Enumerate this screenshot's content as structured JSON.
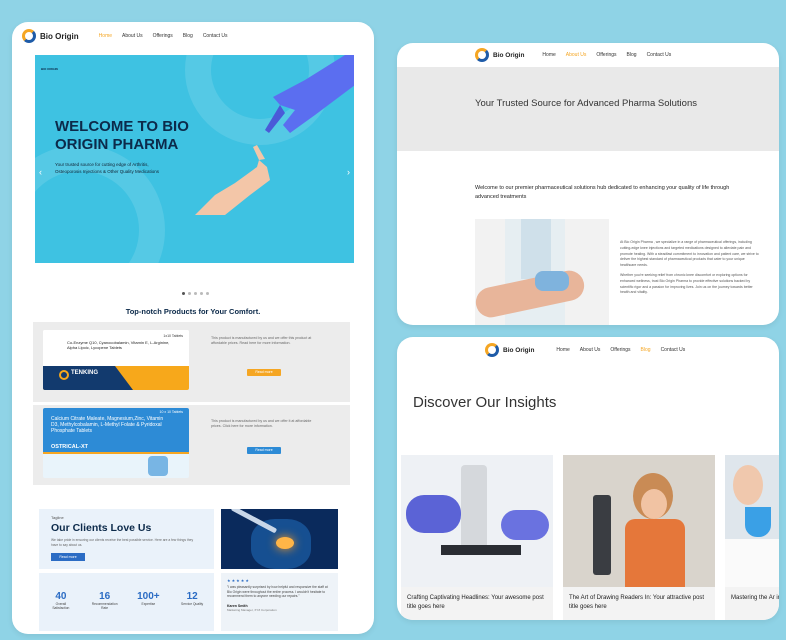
{
  "brand": "Bio Origin",
  "card1": {
    "nav": [
      {
        "label": "Home",
        "active": true
      },
      {
        "label": "About Us",
        "active": false
      },
      {
        "label": "Offerings",
        "active": false
      },
      {
        "label": "Blog",
        "active": false
      },
      {
        "label": "Contact Us",
        "active": false
      }
    ],
    "hero_logo": "BIO ORIGIN",
    "hero_title": "WELCOME TO BIO ORIGIN PHARMA",
    "hero_subtitle": "Your trusted source for cutting edge of Arthritis, Osteoporosis Injections & Other Quality Medications",
    "products_title": "Top-notch Products for Your Comfort.",
    "product1": {
      "tag": "1x10 Tablets",
      "ingredients": "Co-Enzyme Q10, Cyanocobalamin, Vitamin E, L-Arginine, Alpha Lipoic, Lycopene Tablets",
      "name": "TENKING",
      "desc": "This product is manufactured by us and we offer this product at affordable prices. Read here for more information.",
      "button": "Read more"
    },
    "product2": {
      "tag": "10 x 10 Tablets",
      "ingredients": "Calcium Citrate Maleate, Magnesium,Zinc, Vitamin D3, Methylcobalamin, L-Methyl Folate & Pyridoxal Phosphate Tablets",
      "name": "OSTRICAL-XT",
      "desc": "This product is manufactured by us and we offer it at affordable prices. Click here for more information.",
      "button": "Read more"
    },
    "clients": {
      "kicker": "Tagline",
      "heading": "Our Clients Love Us",
      "text": "We take pride in ensuring our clients receive the best possible service. Here are a few things they have to say about us.",
      "button": "Read more"
    },
    "stats": [
      {
        "value": "40",
        "label": "Overall Satisfaction"
      },
      {
        "value": "16",
        "label": "Recommendation Rate"
      },
      {
        "value": "100+",
        "label": "Expertise"
      },
      {
        "value": "12",
        "label": "Service Quality"
      }
    ],
    "testimonial": {
      "stars": "★★★★★",
      "quote": "\"I was pleasantly surprised by how helpful and responsive the staff at Bio Origin were throughout the entire process. I wouldn't hesitate to recommend them to anyone needing our repairs.\"",
      "name": "Karen Smith",
      "role": "Marketing Manager, XYZ Corporation"
    }
  },
  "card2": {
    "nav": [
      {
        "label": "Home",
        "active": false
      },
      {
        "label": "About Us",
        "active": true
      },
      {
        "label": "Offerings",
        "active": false
      },
      {
        "label": "Blog",
        "active": false
      },
      {
        "label": "Contact Us",
        "active": false
      }
    ],
    "band_title": "Your Trusted Source for Advanced Pharma Solutions",
    "welcome": "Welcome to our premier pharmaceutical solutions hub dedicated to enhancing your quality of life through advanced treatments",
    "about_p1": "At Bio Origin Pharma , we specialize in a range of pharmaceutical offerings, including cutting-edge knee injections and targeted medications designed to alleviate pain and promote healing. With a steadfast commitment to innovation and patient care, we strive to deliver the highest standard of pharmaceutical products that cater to your unique healthcare needs.",
    "about_p2": "Whether you're seeking relief from chronic knee discomfort or exploring options for enhanced wellness, trust Bio Origin Pharma to provide effective solutions backed by scientific rigor and a passion for improving lives. Join us on the journey towards better health and vitality."
  },
  "card3": {
    "nav": [
      {
        "label": "Home",
        "active": false
      },
      {
        "label": "About Us",
        "active": false
      },
      {
        "label": "Offerings",
        "active": false
      },
      {
        "label": "Blog",
        "active": true
      },
      {
        "label": "Contact Us",
        "active": false
      }
    ],
    "heading": "Discover Our Insights",
    "posts": [
      {
        "title": "Crafting Captivating Headlines: Your awesome post title goes here"
      },
      {
        "title": "The Art of Drawing Readers In: Your attractive post title goes here"
      },
      {
        "title": "Mastering the Ar intriguing post"
      }
    ]
  },
  "colors": {
    "accent": "#f5a623",
    "brand_blue": "#1e5ba8",
    "hero": "#3ec2e2",
    "background": "#8fd3e6"
  }
}
